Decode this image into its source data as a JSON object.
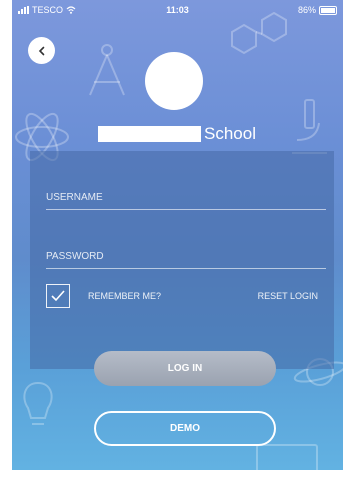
{
  "status_bar": {
    "carrier": "TESCO",
    "time": "11:03",
    "battery": "86%",
    "battery_level": 0.86,
    "icons": [
      "signal-icon",
      "wifi-icon",
      "battery-icon"
    ]
  },
  "header": {
    "back_icon": "chevron-left-icon",
    "school_label": "School"
  },
  "form": {
    "username_placeholder": "USERNAME",
    "username_value": "",
    "password_placeholder": "PASSWORD",
    "password_value": "",
    "remember_label": "REMEMBER ME?",
    "remember_checked": true,
    "reset_label": "RESET LOGIN"
  },
  "actions": {
    "login_label": "LOG IN",
    "demo_label": "DEMO"
  },
  "colors": {
    "gradient_top": "#7d98dc",
    "gradient_bottom": "#62b2e2",
    "panel": "#4669a5",
    "login_button": "#9aa2b0"
  }
}
